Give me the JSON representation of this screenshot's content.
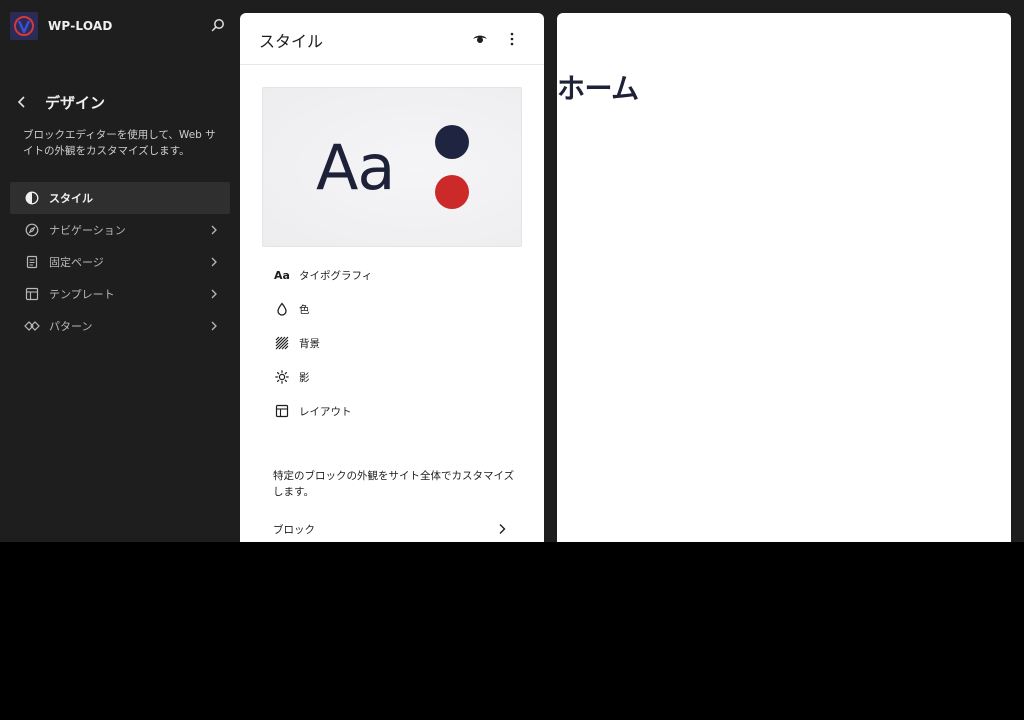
{
  "site": {
    "title": "WP-LOAD"
  },
  "sidebar": {
    "title": "デザイン",
    "description": "ブロックエディターを使用して、Web サイトの外観をカスタマイズします。",
    "items": [
      {
        "label": "スタイル",
        "icon": "half-circle-icon",
        "active": true
      },
      {
        "label": "ナビゲーション",
        "icon": "compass-icon",
        "active": false
      },
      {
        "label": "固定ページ",
        "icon": "page-icon",
        "active": false
      },
      {
        "label": "テンプレート",
        "icon": "layout-icon",
        "active": false
      },
      {
        "label": "パターン",
        "icon": "symbol-icon",
        "active": false
      }
    ]
  },
  "style_panel": {
    "title": "スタイル",
    "preview": {
      "sample_text": "Aa",
      "primary_color": "#1f2541",
      "secondary_color": "#cc2a2a"
    },
    "menu": [
      {
        "label": "タイポグラフィ",
        "icon": "typography-icon",
        "glyph": "Aa"
      },
      {
        "label": "色",
        "icon": "droplet-icon"
      },
      {
        "label": "背景",
        "icon": "background-icon"
      },
      {
        "label": "影",
        "icon": "shadow-icon"
      },
      {
        "label": "レイアウト",
        "icon": "layout-icon"
      }
    ],
    "blocks_description": "特定のブロックの外観をサイト全体でカスタマイズします。",
    "blocks_label": "ブロック"
  },
  "canvas": {
    "heading": "ホーム"
  }
}
